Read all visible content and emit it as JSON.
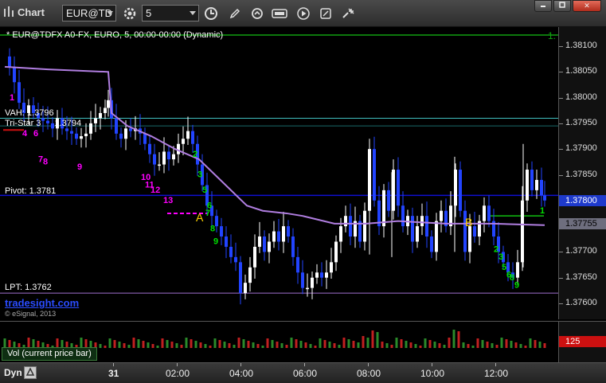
{
  "toolbar": {
    "app_title": "Chart",
    "symbol_value": "EUR@TD",
    "interval_value": "5",
    "window_buttons": {
      "close": "✕"
    }
  },
  "chart": {
    "title": "* EUR@TDFX A0-FX, EURO, 5, 00:00-00:00 (Dynamic)",
    "labels": {
      "vah": "VAH: 1.3796",
      "tristar": "Tri-Star 3",
      "tristar_value": "1.3794",
      "pivot": "Pivot: 1.3781",
      "lpt": "LPT: 1.3762",
      "brand": "tradesight.com",
      "copyright": "© eSignal, 2013",
      "green_right_marker": "1."
    },
    "price_ticks": [
      "1.38100",
      "1.38050",
      "1.38000",
      "1.37950",
      "1.37900",
      "1.37850",
      "1.37800",
      "1.37750",
      "1.37700",
      "1.37650",
      "1.37600"
    ],
    "current_price": "1.37800",
    "vwap_price": "1.37755",
    "markers": [
      {
        "text": "A",
        "color": "#ffd400"
      },
      {
        "text": "B",
        "color": "#ffd400"
      }
    ],
    "sequence_labels": [
      {
        "text": "1",
        "color": "#ff00ff"
      },
      {
        "text": "4",
        "color": "#ff00ff"
      },
      {
        "text": "6",
        "color": "#ff00ff"
      },
      {
        "text": "7",
        "color": "#ff00ff"
      },
      {
        "text": "8",
        "color": "#ff00ff"
      },
      {
        "text": "9",
        "color": "#ff00ff"
      },
      {
        "text": "10",
        "color": "#ff00ff"
      },
      {
        "text": "11",
        "color": "#ff00ff"
      },
      {
        "text": "12",
        "color": "#ff00ff"
      },
      {
        "text": "13",
        "color": "#ff00ff"
      },
      {
        "text": "2",
        "color": "#00e000"
      },
      {
        "text": "3",
        "color": "#00e000"
      },
      {
        "text": "5",
        "color": "#00e000"
      },
      {
        "text": "6",
        "color": "#00e000"
      },
      {
        "text": "7",
        "color": "#00e000"
      },
      {
        "text": "8",
        "color": "#00e000"
      },
      {
        "text": "9",
        "color": "#00e000"
      },
      {
        "text": "2",
        "color": "#00e000"
      },
      {
        "text": "3",
        "color": "#00e000"
      },
      {
        "text": "5",
        "color": "#00e000"
      },
      {
        "text": "6",
        "color": "#00e000"
      },
      {
        "text": "8",
        "color": "#00e000"
      },
      {
        "text": "9",
        "color": "#00e000"
      },
      {
        "text": "1",
        "color": "#00e000"
      }
    ],
    "colors": {
      "up_bar": "#ffffff",
      "down_bar": "#2244ff",
      "vwap": "#b07ee0",
      "pivot_line": "#1010d0",
      "vah_line": "#40c0c0",
      "lpt_line": "#a070d0",
      "top_line": "#10a010",
      "tristar_line": "#cc1010",
      "magenta_dash": "#ff00ff"
    }
  },
  "volume": {
    "legend": "Vol (current price bar)",
    "current_value": "125"
  },
  "time_axis": {
    "dyn_label": "Dyn",
    "labels": [
      "31",
      "02:00",
      "04:00",
      "06:00",
      "08:00",
      "10:00",
      "12:00"
    ]
  }
}
